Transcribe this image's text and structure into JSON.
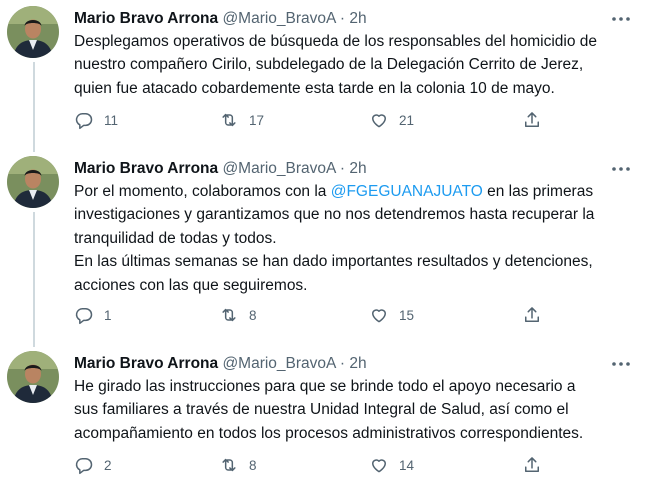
{
  "tweets": [
    {
      "name": "Mario Bravo Arrona",
      "handle": "@Mario_BravoA",
      "separator": "·",
      "time": "2h",
      "text": "Desplegamos operativos de búsqueda de los responsables del homicidio de\nnuestro compañero Cirilo, subdelegado de la Delegación Cerrito de Jerez,\nquien fue atacado cobardemente esta tarde en la colonia 10 de mayo.",
      "replies": "11",
      "retweets": "17",
      "likes": "21"
    },
    {
      "name": "Mario Bravo Arrona",
      "handle": "@Mario_BravoA",
      "separator": "·",
      "time": "2h",
      "text_before": "Por el momento, colaboramos con la ",
      "mention": "@FGEGUANAJUATO",
      "text_after": " en las primeras\ninvestigaciones y garantizamos que no nos detendremos hasta recuperar la\ntranquilidad de todas y todos.\nEn las últimas semanas se han dado importantes resultados y detenciones,\nacciones con las que seguiremos.",
      "replies": "1",
      "retweets": "8",
      "likes": "15"
    },
    {
      "name": "Mario Bravo Arrona",
      "handle": "@Mario_BravoA",
      "separator": "·",
      "time": "2h",
      "text": "He girado las instrucciones para que se brinde todo el apoyo necesario a\nsus familiares a través de nuestra Unidad Integral de Salud, así como el\nacompañamiento en todos los procesos administrativos correspondientes.",
      "replies": "2",
      "retweets": "8",
      "likes": "14"
    }
  ],
  "icons": {
    "more": "more-horizontal-icon",
    "reply": "reply-bubble-icon",
    "retweet": "retweet-icon",
    "like": "heart-icon",
    "share": "share-upload-icon"
  },
  "colors": {
    "text": "#0f1419",
    "secondary": "#536471",
    "link": "#1d9bf0",
    "thread_line": "#cfd9de"
  }
}
